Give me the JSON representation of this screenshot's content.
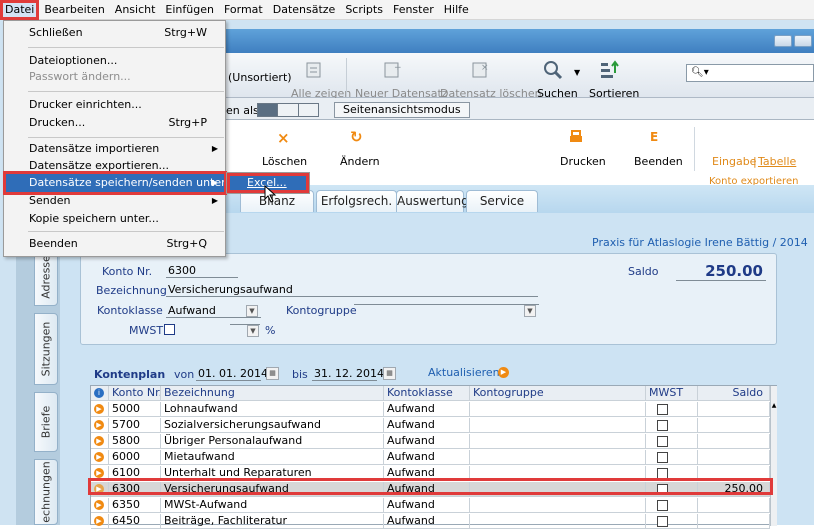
{
  "menubar": {
    "items": [
      "Datei",
      "Bearbeiten",
      "Ansicht",
      "Einfügen",
      "Format",
      "Datensätze",
      "Scripts",
      "Fenster",
      "Hilfe"
    ]
  },
  "file_menu": {
    "items": [
      {
        "label": "Schließen",
        "shortcut": "Strg+W"
      },
      {
        "label": "Dateioptionen..."
      },
      {
        "label": "Passwort ändern...",
        "disabled": true
      },
      {
        "label": "Drucker einrichten..."
      },
      {
        "label": "Drucken...",
        "shortcut": "Strg+P"
      },
      {
        "label": "Datensätze importieren",
        "submenu": true
      },
      {
        "label": "Datensätze exportieren..."
      },
      {
        "label": "Datensätze speichern/senden unter",
        "submenu": true,
        "highlighted": true
      },
      {
        "label": "Senden",
        "submenu": true
      },
      {
        "label": "Kopie speichern unter..."
      },
      {
        "label": "Beenden",
        "shortcut": "Strg+Q"
      }
    ],
    "submenu": {
      "label": "Excel..."
    }
  },
  "toolbar": {
    "sort_status": "(Unsortiert)",
    "show_all": "Alle zeigen",
    "new_record": "Neuer Datensatz",
    "delete_record": "Datensatz löschen",
    "search": "Suchen",
    "sort": "Sortieren",
    "view_as_label": "en als:",
    "page_view_mode": "Seitenansichtsmodus"
  },
  "actions": {
    "delete": "Löschen",
    "change": "Ändern",
    "print": "Drucken",
    "quit": "Beenden",
    "link_input": "Eingabe",
    "link_table": "Tabelle",
    "link_export": "Konto exportieren"
  },
  "tabs": [
    "Bilanz",
    "Erfolgsrech.",
    "Auswertung",
    "Service"
  ],
  "side_tabs": [
    "Adresse",
    "Sitzungen",
    "Briefe",
    "echnungen"
  ],
  "form": {
    "practice": "Praxis für Atlaslogie Irene Bättig / 2014",
    "konto_label": "Konto Nr.",
    "konto_value": "6300",
    "saldo_label": "Saldo",
    "saldo_value": "250.00",
    "bez_label": "Bezeichnung",
    "bez_value": "Versicherungsaufwand",
    "klasse_label": "Kontoklasse",
    "klasse_value": "Aufwand",
    "gruppe_label": "Kontogruppe",
    "mwst_label": "MWST",
    "percent": "%"
  },
  "kontenplan": {
    "title": "Kontenplan",
    "from_label": "von",
    "from": "01. 01. 2014",
    "to_label": "bis",
    "to": "31. 12. 2014",
    "refresh": "Aktualisieren"
  },
  "table": {
    "headers": [
      "Konto Nr.",
      "Bezeichnung",
      "Kontoklasse",
      "Kontogruppe",
      "MWST",
      "Saldo"
    ],
    "rows": [
      {
        "nr": "5000",
        "bez": "Lohnaufwand",
        "klasse": "Aufwand",
        "saldo": ""
      },
      {
        "nr": "5700",
        "bez": "Sozialversicherungsaufwand",
        "klasse": "Aufwand",
        "saldo": ""
      },
      {
        "nr": "5800",
        "bez": "Übriger Personalaufwand",
        "klasse": "Aufwand",
        "saldo": ""
      },
      {
        "nr": "6000",
        "bez": "Mietaufwand",
        "klasse": "Aufwand",
        "saldo": ""
      },
      {
        "nr": "6100",
        "bez": "Unterhalt und Reparaturen",
        "klasse": "Aufwand",
        "saldo": ""
      },
      {
        "nr": "6300",
        "bez": "Versicherungsaufwand",
        "klasse": "Aufwand",
        "saldo": "250.00",
        "selected": true
      },
      {
        "nr": "6350",
        "bez": "MWSt-Aufwand",
        "klasse": "Aufwand",
        "saldo": ""
      },
      {
        "nr": "6450",
        "bez": "Beiträge, Fachliteratur",
        "klasse": "Aufwand",
        "saldo": ""
      }
    ]
  },
  "colors": {
    "accent": "#e03a3a",
    "titlebar": "#4a8bcc",
    "link": "#1f5fb0",
    "orange": "#f08a12"
  }
}
